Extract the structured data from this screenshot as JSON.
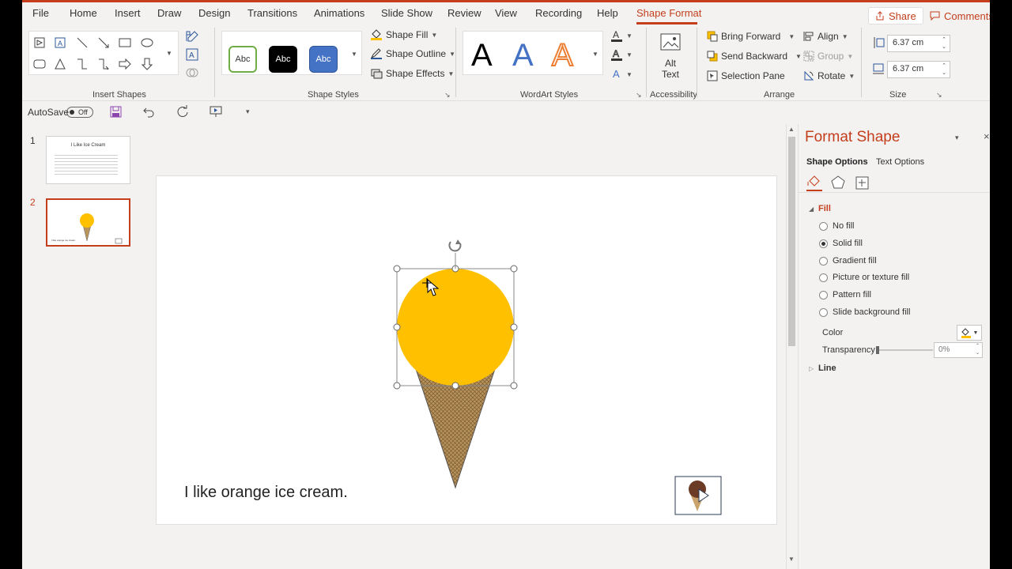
{
  "tabs": [
    "File",
    "Home",
    "Insert",
    "Draw",
    "Design",
    "Transitions",
    "Animations",
    "Slide Show",
    "Review",
    "View",
    "Recording",
    "Help",
    "Shape Format"
  ],
  "share_label": "Share",
  "comments_label": "Comments",
  "ribbon": {
    "groups": {
      "insert_shapes": "Insert Shapes",
      "shape_styles": "Shape Styles",
      "wordart_styles": "WordArt Styles",
      "accessibility": "Accessibility",
      "arrange": "Arrange",
      "size": "Size"
    },
    "style_sample": "Abc",
    "shape_fill": "Shape Fill",
    "shape_outline": "Shape Outline",
    "shape_effects": "Shape Effects",
    "wordart_letter": "A",
    "alt_text_line1": "Alt",
    "alt_text_line2": "Text",
    "bring_forward": "Bring Forward",
    "send_backward": "Send Backward",
    "selection_pane": "Selection Pane",
    "align": "Align",
    "group": "Group",
    "rotate": "Rotate",
    "height": "6.37 cm",
    "width": "6.37 cm"
  },
  "qat": {
    "autosave": "AutoSave",
    "toggle": "Off"
  },
  "slides": [
    {
      "number": "1",
      "title": "I Like Ice Cream"
    },
    {
      "number": "2",
      "caption": "I like orange ice cream."
    }
  ],
  "slide": {
    "caption": "I like orange ice cream."
  },
  "pane": {
    "title": "Format Shape",
    "tab_shape": "Shape Options",
    "tab_text": "Text Options",
    "fill_header": "Fill",
    "fill_options": [
      "No fill",
      "Solid fill",
      "Gradient fill",
      "Picture or texture fill",
      "Pattern fill",
      "Slide background fill"
    ],
    "selected_fill": "Solid fill",
    "color_label": "Color",
    "transparency_label": "Transparency",
    "transparency_value": "0%",
    "line_header": "Line"
  },
  "colors": {
    "accent": "#c43e1c",
    "scoop": "#ffc000",
    "cone": "#b8945c"
  }
}
